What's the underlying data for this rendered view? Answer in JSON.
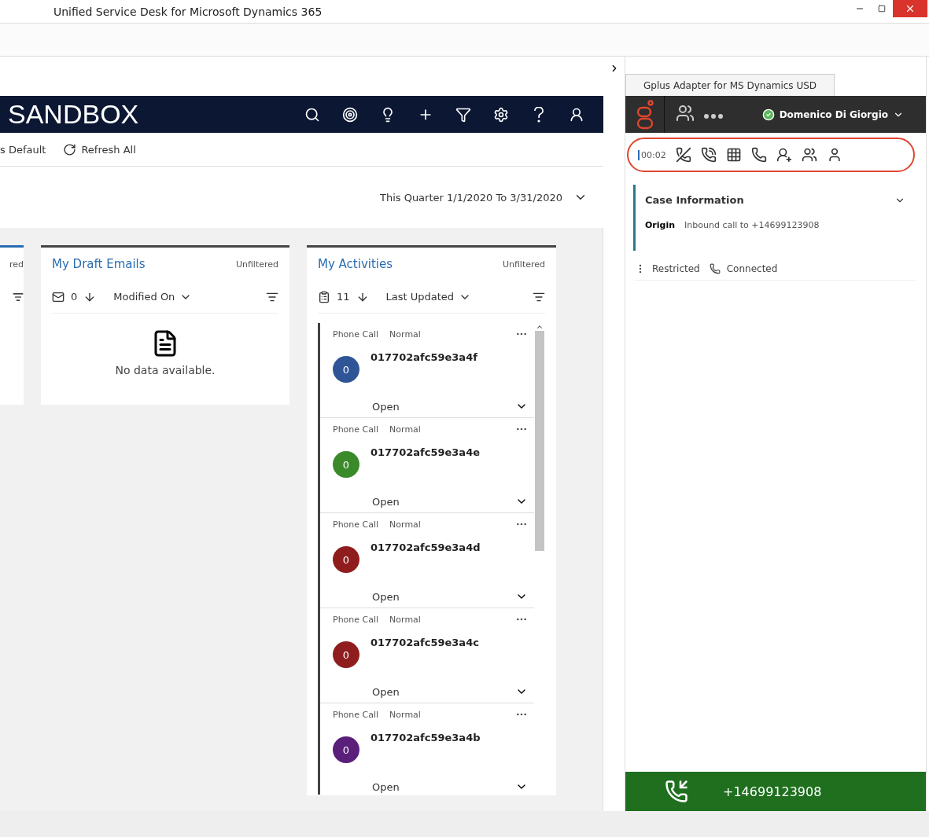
{
  "window": {
    "title": "Unified Service Desk for Microsoft Dynamics 365"
  },
  "navbar": {
    "title": "SANDBOX"
  },
  "command_bar": {
    "items": [
      {
        "kind": "text",
        "label": "s Default"
      },
      {
        "kind": "refresh",
        "label": "Refresh All"
      }
    ]
  },
  "date_filter": {
    "label": "This Quarter 1/1/2020 To 3/31/2020"
  },
  "partial_card": {
    "filter": "red"
  },
  "draft_emails": {
    "title": "My Draft Emails",
    "filter": "Unfiltered",
    "count": "0",
    "sort": "Modified On",
    "empty_text": "No data available."
  },
  "activities": {
    "title": "My Activities",
    "filter": "Unfiltered",
    "count": "11",
    "sort": "Last Updated",
    "items": [
      {
        "type": "Phone Call",
        "priority": "Normal",
        "avatar": "0",
        "color": "#2f5597",
        "subject": "017702afc59e3a4f",
        "status": "Open"
      },
      {
        "type": "Phone Call",
        "priority": "Normal",
        "avatar": "0",
        "color": "#3a8a2a",
        "subject": "017702afc59e3a4e",
        "status": "Open"
      },
      {
        "type": "Phone Call",
        "priority": "Normal",
        "avatar": "0",
        "color": "#8f1d1d",
        "subject": "017702afc59e3a4d",
        "status": "Open"
      },
      {
        "type": "Phone Call",
        "priority": "Normal",
        "avatar": "0",
        "color": "#8f1d1d",
        "subject": "017702afc59e3a4c",
        "status": "Open"
      },
      {
        "type": "Phone Call",
        "priority": "Normal",
        "avatar": "0",
        "color": "#5a1f7a",
        "subject": "017702afc59e3a4b",
        "status": "Open"
      }
    ]
  },
  "adapter": {
    "tab": "Gplus Adapter for MS Dynamics USD",
    "agent": "Domenico Di Giorgio",
    "timer": "00:02",
    "case": {
      "title": "Case Information",
      "origin_label": "Origin",
      "origin_value": "Inbound call to +14699123908"
    },
    "status": [
      {
        "kind": "menu",
        "label": "Restricted"
      },
      {
        "kind": "phone",
        "label": "Connected"
      }
    ],
    "call_bar": {
      "number": "+14699123908"
    }
  }
}
